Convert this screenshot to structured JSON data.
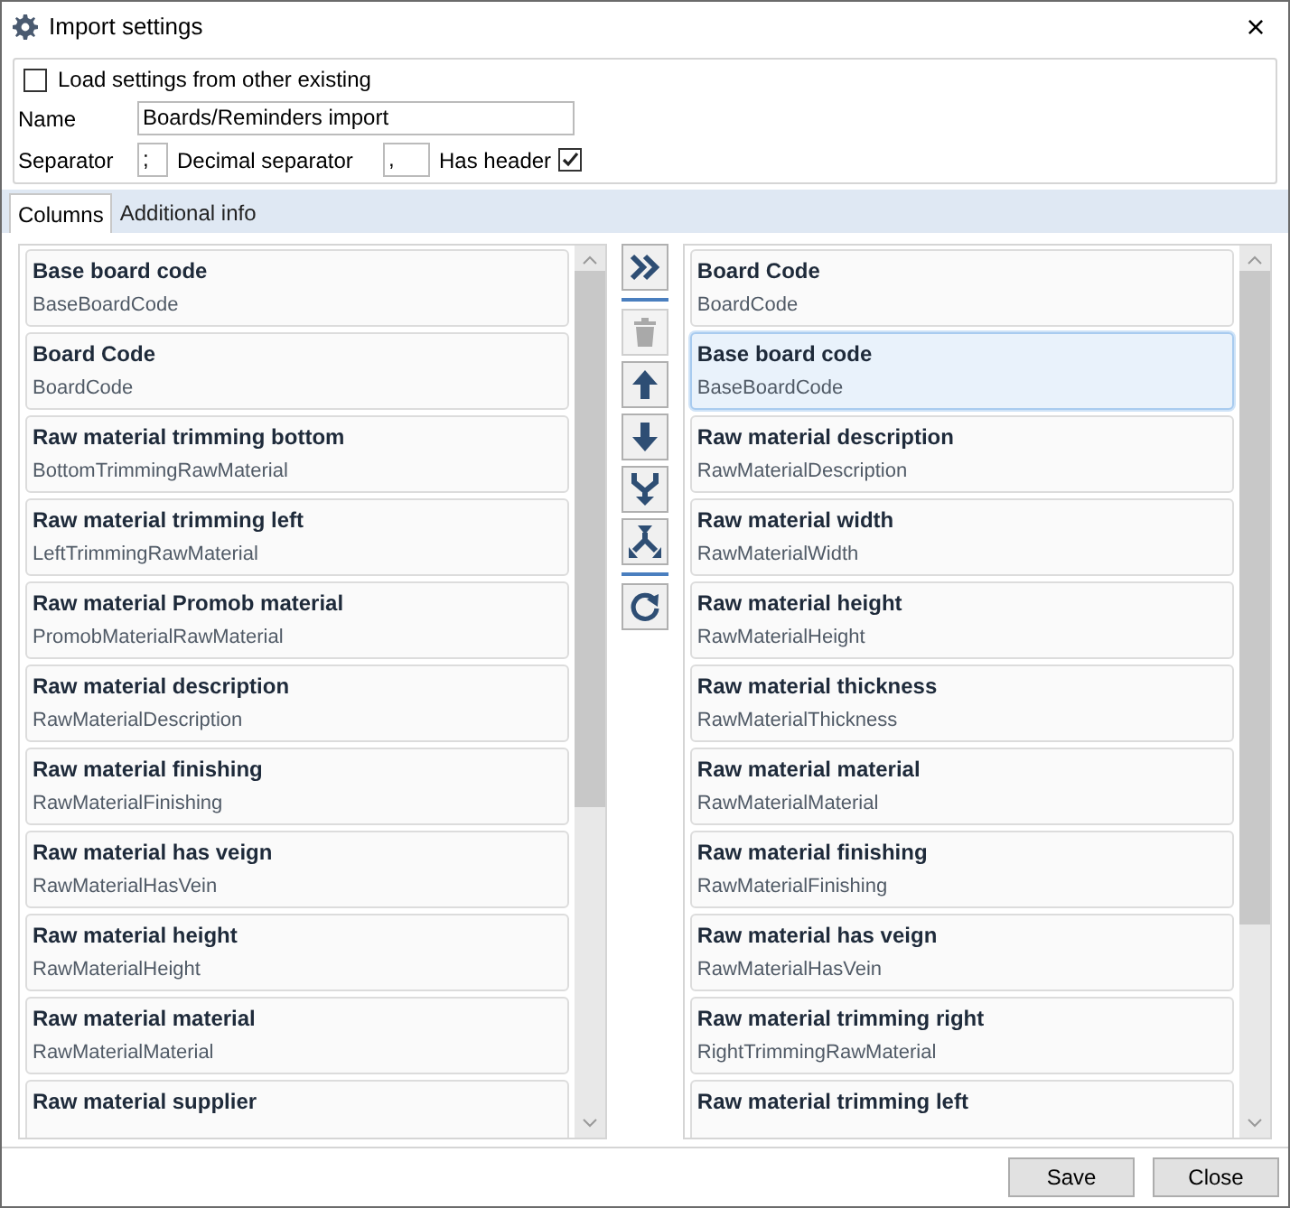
{
  "window": {
    "title": "Import settings",
    "close": "×"
  },
  "settings": {
    "load_from_existing": {
      "label": "Load settings from other existing",
      "checked": false
    },
    "name": {
      "label": "Name",
      "value": "Boards/Reminders import"
    },
    "separator": {
      "label": "Separator",
      "value": ";"
    },
    "decimal_separator": {
      "label": "Decimal separator",
      "value": ","
    },
    "has_header": {
      "label": "Has header",
      "checked": true
    }
  },
  "tabs": [
    {
      "label": "Columns",
      "selected": true
    },
    {
      "label": "Additional info",
      "selected": false
    }
  ],
  "available_columns": [
    {
      "title": "Base board code",
      "field": "BaseBoardCode",
      "selected": false
    },
    {
      "title": "Board Code",
      "field": "BoardCode",
      "selected": false
    },
    {
      "title": "Raw material trimming bottom",
      "field": "BottomTrimmingRawMaterial",
      "selected": false
    },
    {
      "title": "Raw material trimming left",
      "field": "LeftTrimmingRawMaterial",
      "selected": false
    },
    {
      "title": "Raw material Promob material",
      "field": "PromobMaterialRawMaterial",
      "selected": false
    },
    {
      "title": "Raw material description",
      "field": "RawMaterialDescription",
      "selected": false
    },
    {
      "title": "Raw material finishing",
      "field": "RawMaterialFinishing",
      "selected": false
    },
    {
      "title": "Raw material has veign",
      "field": "RawMaterialHasVein",
      "selected": false
    },
    {
      "title": "Raw material height",
      "field": "RawMaterialHeight",
      "selected": false
    },
    {
      "title": "Raw material material",
      "field": "RawMaterialMaterial",
      "selected": false
    },
    {
      "title": "Raw material supplier",
      "selected": false
    }
  ],
  "actions": [
    {
      "kind": "add-all",
      "disabled": false
    },
    {
      "kind": "delete",
      "disabled": true
    },
    {
      "kind": "up",
      "disabled": false
    },
    {
      "kind": "down",
      "disabled": false
    },
    {
      "kind": "merge",
      "disabled": false
    },
    {
      "kind": "split",
      "disabled": false
    },
    {
      "kind": "reset",
      "disabled": false
    }
  ],
  "selected_columns": [
    {
      "title": "Board Code",
      "field": "BoardCode",
      "selected": false
    },
    {
      "title": "Base board code",
      "field": "BaseBoardCode",
      "selected": true
    },
    {
      "title": "Raw material description",
      "field": "RawMaterialDescription",
      "selected": false
    },
    {
      "title": "Raw material width",
      "field": "RawMaterialWidth",
      "selected": false
    },
    {
      "title": "Raw material height",
      "field": "RawMaterialHeight",
      "selected": false
    },
    {
      "title": "Raw material thickness",
      "field": "RawMaterialThickness",
      "selected": false
    },
    {
      "title": "Raw material material",
      "field": "RawMaterialMaterial",
      "selected": false
    },
    {
      "title": "Raw material finishing",
      "field": "RawMaterialFinishing",
      "selected": false
    },
    {
      "title": "Raw material has veign",
      "field": "RawMaterialHasVein",
      "selected": false
    },
    {
      "title": "Raw material trimming right",
      "field": "RightTrimmingRawMaterial",
      "selected": false
    },
    {
      "title": "Raw material trimming left",
      "selected": false
    }
  ],
  "buttons": [
    {
      "label": "Save"
    },
    {
      "label": "Close"
    }
  ]
}
